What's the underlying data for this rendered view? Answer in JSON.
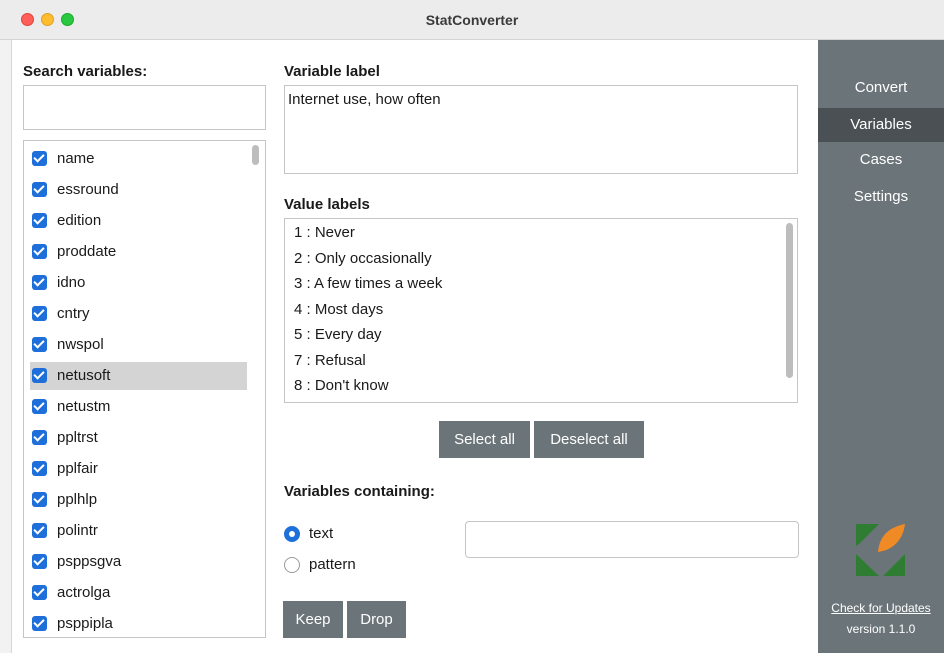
{
  "window": {
    "title": "StatConverter"
  },
  "search": {
    "title": "Search variables:",
    "value": ""
  },
  "variables": [
    {
      "name": "name",
      "checked": true,
      "selected": false
    },
    {
      "name": "essround",
      "checked": true,
      "selected": false
    },
    {
      "name": "edition",
      "checked": true,
      "selected": false
    },
    {
      "name": "proddate",
      "checked": true,
      "selected": false
    },
    {
      "name": "idno",
      "checked": true,
      "selected": false
    },
    {
      "name": "cntry",
      "checked": true,
      "selected": false
    },
    {
      "name": "nwspol",
      "checked": true,
      "selected": false
    },
    {
      "name": "netusoft",
      "checked": true,
      "selected": true
    },
    {
      "name": "netustm",
      "checked": true,
      "selected": false
    },
    {
      "name": "ppltrst",
      "checked": true,
      "selected": false
    },
    {
      "name": "pplfair",
      "checked": true,
      "selected": false
    },
    {
      "name": "pplhlp",
      "checked": true,
      "selected": false
    },
    {
      "name": "polintr",
      "checked": true,
      "selected": false
    },
    {
      "name": "psppsgva",
      "checked": true,
      "selected": false
    },
    {
      "name": "actrolga",
      "checked": true,
      "selected": false
    },
    {
      "name": "psppipla",
      "checked": true,
      "selected": false
    }
  ],
  "variable_label": {
    "title": "Variable label",
    "value": "Internet use, how often"
  },
  "value_labels": {
    "title": "Value labels",
    "items": [
      "1 : Never",
      "2 : Only occasionally",
      "3 : A few times a week",
      "4 : Most days",
      "5 : Every day",
      "7 : Refusal",
      "8 : Don't know"
    ]
  },
  "buttons": {
    "select_all": "Select all",
    "deselect_all": "Deselect all",
    "keep": "Keep",
    "drop": "Drop"
  },
  "containing": {
    "title": "Variables containing:",
    "options": [
      {
        "label": "text",
        "checked": true
      },
      {
        "label": "pattern",
        "checked": false
      }
    ],
    "value": ""
  },
  "sidebar": {
    "items": [
      {
        "label": "Convert",
        "active": false
      },
      {
        "label": "Variables",
        "active": true
      },
      {
        "label": "Cases",
        "active": false
      },
      {
        "label": "Settings",
        "active": false
      }
    ],
    "check_updates": "Check for Updates",
    "version": "version 1.1.0"
  },
  "colors": {
    "accent": "#1e6fd9",
    "sidebar": "#6b7479",
    "sidebar_active": "#4a5054",
    "logo_green": "#2e7d32",
    "logo_orange": "#f08a24"
  }
}
